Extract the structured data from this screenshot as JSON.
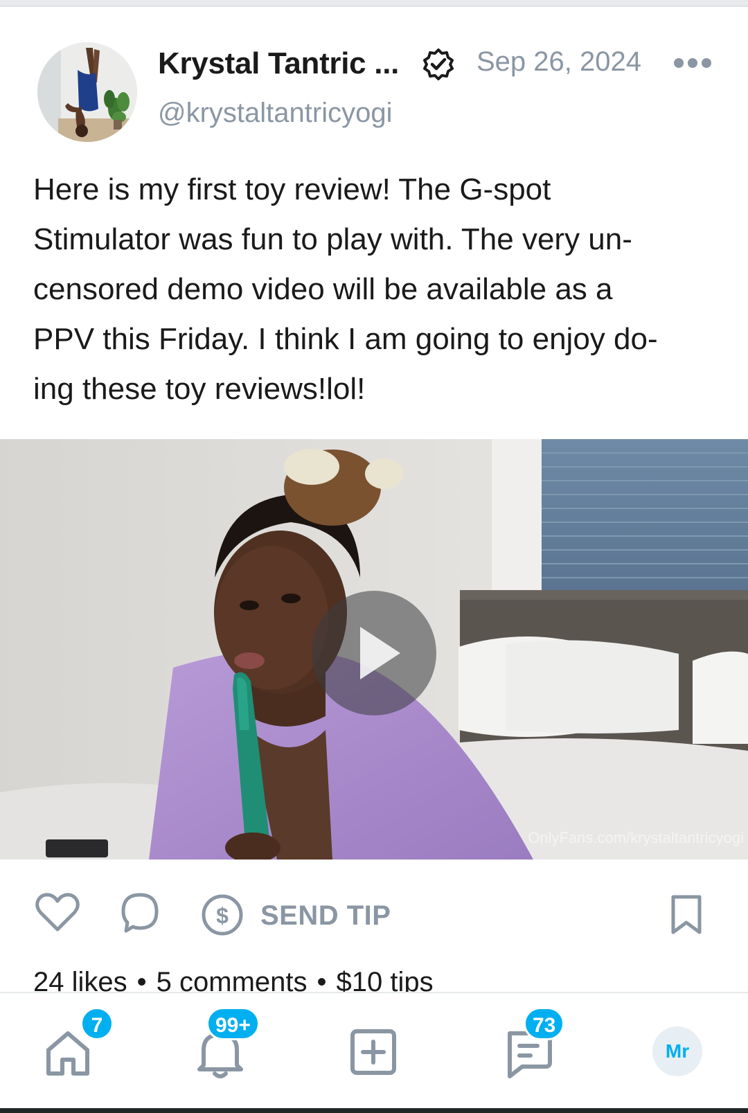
{
  "post": {
    "author_name": "Krystal Tantric ...",
    "handle": "@krystaltantricyogi",
    "date": "Sep 26, 2024",
    "text": "Here is my first toy review! The G-spot Stimulator was fun to play with. The very un-censored demo video will be available as a PPV this Friday. I think I am going to enjoy do-ing these toy reviews!lol!",
    "text_lines": [
      "Here is my first toy review! The G-spot",
      "Stimulator was fun to play with. The very un-",
      "censored demo video will be available as a",
      "PPV this Friday. I think I am going to enjoy do-",
      "ing these toy reviews!lol!"
    ],
    "media": {
      "type": "video",
      "watermark": "OnlyFans.com/krystaltantricyogi"
    }
  },
  "actions": {
    "like_icon": "heart-icon",
    "comment_icon": "comment-icon",
    "tip_icon": "dollar-circle-icon",
    "tip_label": "SEND TIP",
    "bookmark_icon": "bookmark-icon"
  },
  "stats": {
    "likes": "24 likes",
    "comments": "5 comments",
    "tips": "$10 tips"
  },
  "bottom_nav": {
    "home": {
      "icon": "home-icon",
      "badge": "7"
    },
    "notifications": {
      "icon": "bell-icon",
      "badge": "99+"
    },
    "add": {
      "icon": "add-post-icon"
    },
    "messages": {
      "icon": "chat-icon",
      "badge": "73"
    },
    "profile": {
      "initials": "Mr"
    }
  },
  "colors": {
    "accent": "#00aff0",
    "muted": "#8a96a3",
    "text": "#1a1a1a"
  }
}
